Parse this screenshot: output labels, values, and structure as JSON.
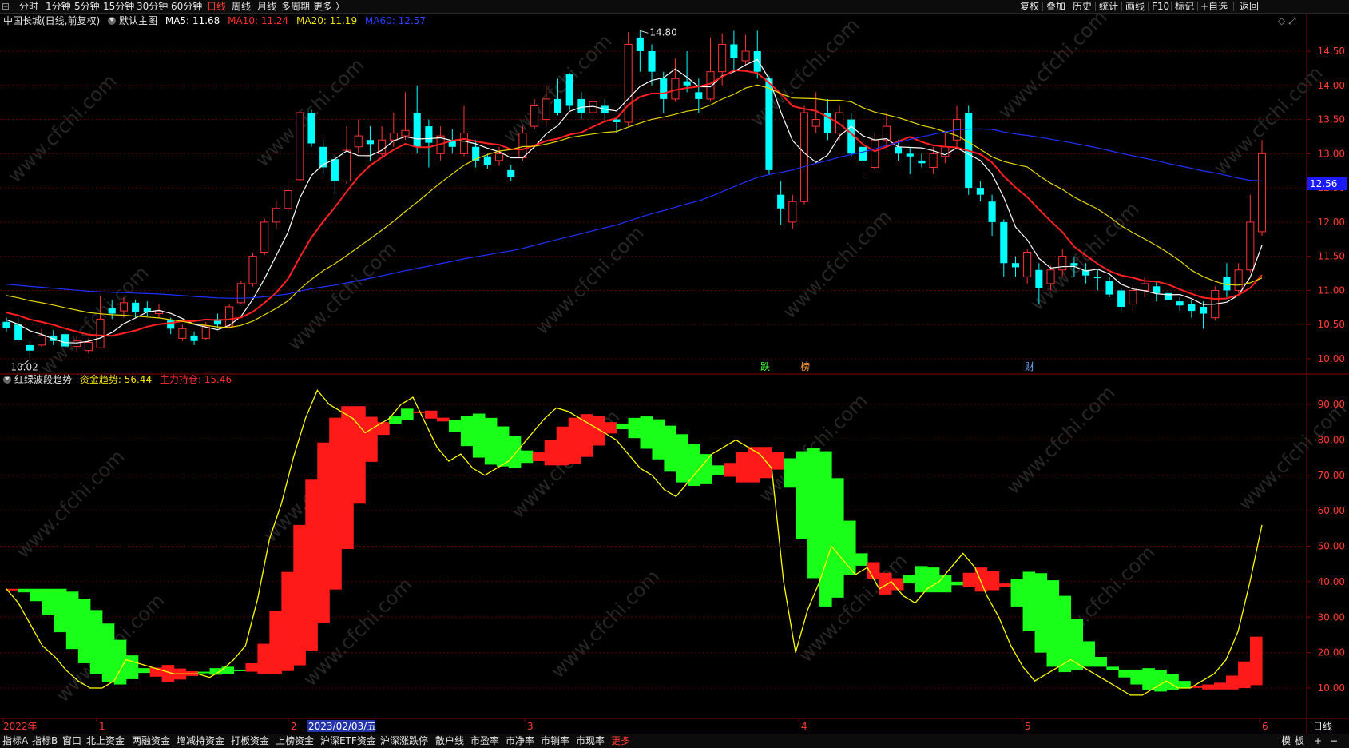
{
  "toolbar": {
    "periods": [
      "分时",
      "1分钟",
      "5分钟",
      "15分钟",
      "30分钟",
      "60分钟",
      "日线",
      "周线",
      "月线",
      "多周期",
      "更多 〉"
    ],
    "active_period": "日线",
    "right_items": [
      "复权",
      "叠加",
      "历史",
      "统计",
      "画线",
      "F10",
      "标记",
      "+自选",
      "返回"
    ]
  },
  "main_panel": {
    "stock_title": "中国长城(日线,前复权)",
    "main_chart_label": "默认主图",
    "ma": [
      {
        "label": "MA5:",
        "value": "11.68",
        "color": "#ffffff"
      },
      {
        "label": "MA10:",
        "value": "11.24",
        "color": "#ff2d2d"
      },
      {
        "label": "MA20:",
        "value": "11.19",
        "color": "#f0e000"
      },
      {
        "label": "MA60:",
        "value": "12.57",
        "color": "#2b3cff"
      }
    ],
    "y_ticks": [
      "14.50",
      "14.00",
      "13.50",
      "13.00",
      "12.50",
      "12.00",
      "11.50",
      "11.00",
      "10.50",
      "10.00"
    ],
    "high_label": "14.80",
    "low_label": "10.02",
    "price_tag": "12.56",
    "markers": [
      {
        "text": "跌",
        "color": "#3cff3c"
      },
      {
        "text": "榜",
        "color": "#ff9a3c"
      },
      {
        "text": "财",
        "color": "#6aa0ff"
      }
    ]
  },
  "sub_panel": {
    "indicator_name": "红绿波段趋势",
    "fund_trend": {
      "label": "资金趋势:",
      "value": "56.44",
      "color": "#f0e000"
    },
    "main_holding": {
      "label": "主力持仓:",
      "value": "15.46",
      "color": "#ff2d2d"
    },
    "y_ticks": [
      "90.00",
      "80.00",
      "70.00",
      "60.00",
      "50.00",
      "40.00",
      "30.00",
      "20.00",
      "10.00"
    ]
  },
  "x_axis": {
    "labels": [
      "2022年",
      "1",
      "2",
      "2023/02/03/五",
      "3",
      "4",
      "5",
      "6"
    ],
    "period_label": "日线"
  },
  "bottom_tabs": [
    "指标A",
    "指标B",
    "窗口",
    "北上资金",
    "两融资金",
    "增减持资金",
    "打板资金",
    "上榜资金",
    "沪深ETF资金",
    "沪深涨跌停",
    "散户线",
    "市盈率",
    "市净率",
    "市销率",
    "市现率",
    "更多"
  ],
  "bottom_right": [
    "模",
    "板",
    "+",
    "−"
  ],
  "watermark": "www.cfchi.com",
  "chart_data": {
    "type": "candlestick",
    "candles": [
      {
        "o": 10.54,
        "c": 10.45,
        "h": 10.6,
        "l": 10.4
      },
      {
        "o": 10.5,
        "c": 10.28,
        "h": 10.6,
        "l": 10.25
      },
      {
        "o": 10.2,
        "c": 10.12,
        "h": 10.28,
        "l": 10.02
      },
      {
        "o": 10.2,
        "c": 10.34,
        "h": 10.44,
        "l": 10.18
      },
      {
        "o": 10.34,
        "c": 10.26,
        "h": 10.42,
        "l": 10.2
      },
      {
        "o": 10.36,
        "c": 10.18,
        "h": 10.4,
        "l": 10.12
      },
      {
        "o": 10.18,
        "c": 10.26,
        "h": 10.34,
        "l": 10.1
      },
      {
        "o": 10.12,
        "c": 10.24,
        "h": 10.3,
        "l": 10.08
      },
      {
        "o": 10.16,
        "c": 10.58,
        "h": 10.92,
        "l": 10.15
      },
      {
        "o": 10.74,
        "c": 10.66,
        "h": 10.86,
        "l": 10.58
      },
      {
        "o": 10.7,
        "c": 10.82,
        "h": 10.9,
        "l": 10.6
      },
      {
        "o": 10.82,
        "c": 10.68,
        "h": 10.86,
        "l": 10.6
      },
      {
        "o": 10.74,
        "c": 10.68,
        "h": 10.84,
        "l": 10.62
      },
      {
        "o": 10.66,
        "c": 10.7,
        "h": 10.8,
        "l": 10.6
      },
      {
        "o": 10.56,
        "c": 10.44,
        "h": 10.6,
        "l": 10.36
      },
      {
        "o": 10.3,
        "c": 10.44,
        "h": 10.5,
        "l": 10.26
      },
      {
        "o": 10.34,
        "c": 10.26,
        "h": 10.4,
        "l": 10.2
      },
      {
        "o": 10.3,
        "c": 10.48,
        "h": 10.54,
        "l": 10.28
      },
      {
        "o": 10.58,
        "c": 10.5,
        "h": 10.66,
        "l": 10.44
      },
      {
        "o": 10.48,
        "c": 10.76,
        "h": 10.8,
        "l": 10.44
      },
      {
        "o": 10.82,
        "c": 11.1,
        "h": 11.14,
        "l": 10.8
      },
      {
        "o": 11.1,
        "c": 11.5,
        "h": 11.55,
        "l": 11.06
      },
      {
        "o": 11.56,
        "c": 12.0,
        "h": 12.05,
        "l": 11.52
      },
      {
        "o": 12.0,
        "c": 12.2,
        "h": 12.3,
        "l": 11.9
      },
      {
        "o": 12.2,
        "c": 12.46,
        "h": 12.6,
        "l": 12.1
      },
      {
        "o": 12.62,
        "c": 13.6,
        "h": 13.62,
        "l": 12.6
      },
      {
        "o": 13.6,
        "c": 13.15,
        "h": 13.64,
        "l": 13.1
      },
      {
        "o": 13.1,
        "c": 12.8,
        "h": 13.2,
        "l": 12.7
      },
      {
        "o": 12.92,
        "c": 12.6,
        "h": 13.0,
        "l": 12.4
      },
      {
        "o": 12.6,
        "c": 13.05,
        "h": 13.4,
        "l": 12.56
      },
      {
        "o": 13.1,
        "c": 13.26,
        "h": 13.5,
        "l": 13.0
      },
      {
        "o": 13.2,
        "c": 13.14,
        "h": 13.4,
        "l": 12.9
      },
      {
        "o": 13.0,
        "c": 13.2,
        "h": 13.4,
        "l": 12.96
      },
      {
        "o": 13.2,
        "c": 13.3,
        "h": 13.6,
        "l": 13.1
      },
      {
        "o": 13.26,
        "c": 13.34,
        "h": 13.9,
        "l": 13.2
      },
      {
        "o": 13.6,
        "c": 13.1,
        "h": 14.0,
        "l": 13.0
      },
      {
        "o": 13.4,
        "c": 13.16,
        "h": 13.5,
        "l": 12.8
      },
      {
        "o": 13.0,
        "c": 13.26,
        "h": 13.4,
        "l": 12.9
      },
      {
        "o": 13.2,
        "c": 13.1,
        "h": 13.36,
        "l": 13.0
      },
      {
        "o": 13.0,
        "c": 13.3,
        "h": 13.7,
        "l": 12.96
      },
      {
        "o": 13.1,
        "c": 12.9,
        "h": 13.2,
        "l": 12.8
      },
      {
        "o": 12.96,
        "c": 12.84,
        "h": 13.0,
        "l": 12.78
      },
      {
        "o": 12.9,
        "c": 13.0,
        "h": 13.1,
        "l": 12.82
      },
      {
        "o": 12.76,
        "c": 12.66,
        "h": 12.84,
        "l": 12.6
      },
      {
        "o": 12.94,
        "c": 13.3,
        "h": 13.4,
        "l": 12.9
      },
      {
        "o": 13.4,
        "c": 13.7,
        "h": 13.8,
        "l": 13.36
      },
      {
        "o": 13.5,
        "c": 13.8,
        "h": 14.0,
        "l": 13.4
      },
      {
        "o": 13.8,
        "c": 13.6,
        "h": 14.1,
        "l": 13.56
      },
      {
        "o": 14.16,
        "c": 13.7,
        "h": 14.18,
        "l": 13.64
      },
      {
        "o": 13.8,
        "c": 13.6,
        "h": 13.9,
        "l": 13.5
      },
      {
        "o": 13.6,
        "c": 13.76,
        "h": 13.84,
        "l": 13.5
      },
      {
        "o": 13.7,
        "c": 13.6,
        "h": 13.8,
        "l": 13.46
      },
      {
        "o": 13.5,
        "c": 13.46,
        "h": 13.54,
        "l": 13.3
      },
      {
        "o": 13.46,
        "c": 14.6,
        "h": 14.78,
        "l": 13.4
      },
      {
        "o": 14.7,
        "c": 14.5,
        "h": 14.8,
        "l": 14.2
      },
      {
        "o": 14.5,
        "c": 14.2,
        "h": 14.6,
        "l": 14.0
      },
      {
        "o": 14.1,
        "c": 13.8,
        "h": 14.2,
        "l": 13.6
      },
      {
        "o": 13.8,
        "c": 14.1,
        "h": 14.4,
        "l": 13.76
      },
      {
        "o": 14.06,
        "c": 14.0,
        "h": 14.5,
        "l": 13.9
      },
      {
        "o": 13.9,
        "c": 13.8,
        "h": 14.1,
        "l": 13.6
      },
      {
        "o": 13.8,
        "c": 14.2,
        "h": 14.7,
        "l": 13.76
      },
      {
        "o": 14.2,
        "c": 14.6,
        "h": 14.76,
        "l": 14.0
      },
      {
        "o": 14.6,
        "c": 14.4,
        "h": 14.8,
        "l": 14.2
      },
      {
        "o": 14.36,
        "c": 14.5,
        "h": 14.74,
        "l": 14.3
      },
      {
        "o": 14.5,
        "c": 14.2,
        "h": 14.8,
        "l": 14.1
      },
      {
        "o": 14.1,
        "c": 12.76,
        "h": 14.14,
        "l": 12.7
      },
      {
        "o": 12.4,
        "c": 12.2,
        "h": 12.6,
        "l": 11.96
      },
      {
        "o": 12.0,
        "c": 12.3,
        "h": 12.4,
        "l": 11.9
      },
      {
        "o": 12.3,
        "c": 13.6,
        "h": 13.7,
        "l": 12.26
      },
      {
        "o": 13.4,
        "c": 13.5,
        "h": 13.9,
        "l": 13.3
      },
      {
        "o": 13.6,
        "c": 13.3,
        "h": 13.8,
        "l": 13.2
      },
      {
        "o": 13.3,
        "c": 13.6,
        "h": 13.7,
        "l": 13.2
      },
      {
        "o": 13.5,
        "c": 13.0,
        "h": 13.6,
        "l": 12.96
      },
      {
        "o": 13.1,
        "c": 12.9,
        "h": 13.2,
        "l": 12.7
      },
      {
        "o": 12.8,
        "c": 13.2,
        "h": 13.3,
        "l": 12.76
      },
      {
        "o": 13.2,
        "c": 13.4,
        "h": 13.6,
        "l": 13.1
      },
      {
        "o": 13.1,
        "c": 13.0,
        "h": 13.2,
        "l": 12.9
      },
      {
        "o": 13.0,
        "c": 12.96,
        "h": 13.1,
        "l": 12.7
      },
      {
        "o": 12.9,
        "c": 12.86,
        "h": 13.0,
        "l": 12.8
      },
      {
        "o": 12.8,
        "c": 13.0,
        "h": 13.1,
        "l": 12.7
      },
      {
        "o": 12.96,
        "c": 13.1,
        "h": 13.3,
        "l": 12.86
      },
      {
        "o": 13.2,
        "c": 13.5,
        "h": 13.7,
        "l": 13.1
      },
      {
        "o": 13.6,
        "c": 12.5,
        "h": 13.7,
        "l": 12.4
      },
      {
        "o": 12.5,
        "c": 12.4,
        "h": 12.6,
        "l": 12.3
      },
      {
        "o": 12.3,
        "c": 12.0,
        "h": 12.4,
        "l": 11.8
      },
      {
        "o": 12.0,
        "c": 11.4,
        "h": 12.04,
        "l": 11.2
      },
      {
        "o": 11.4,
        "c": 11.34,
        "h": 11.5,
        "l": 11.2
      },
      {
        "o": 11.2,
        "c": 11.56,
        "h": 11.6,
        "l": 11.1
      },
      {
        "o": 11.3,
        "c": 11.04,
        "h": 11.4,
        "l": 10.8
      },
      {
        "o": 11.1,
        "c": 11.3,
        "h": 11.36,
        "l": 11.0
      },
      {
        "o": 11.3,
        "c": 11.5,
        "h": 11.6,
        "l": 11.2
      },
      {
        "o": 11.4,
        "c": 11.36,
        "h": 11.5,
        "l": 11.2
      },
      {
        "o": 11.3,
        "c": 11.22,
        "h": 11.4,
        "l": 11.1
      },
      {
        "o": 11.2,
        "c": 11.18,
        "h": 11.3,
        "l": 11.0
      },
      {
        "o": 11.14,
        "c": 10.94,
        "h": 11.2,
        "l": 10.9
      },
      {
        "o": 11.0,
        "c": 10.76,
        "h": 11.04,
        "l": 10.7
      },
      {
        "o": 10.8,
        "c": 11.0,
        "h": 11.1,
        "l": 10.7
      },
      {
        "o": 11.0,
        "c": 11.1,
        "h": 11.2,
        "l": 10.9
      },
      {
        "o": 11.06,
        "c": 10.96,
        "h": 11.14,
        "l": 10.84
      },
      {
        "o": 10.96,
        "c": 10.86,
        "h": 11.0,
        "l": 10.8
      },
      {
        "o": 10.84,
        "c": 10.78,
        "h": 10.9,
        "l": 10.7
      },
      {
        "o": 10.8,
        "c": 10.7,
        "h": 10.86,
        "l": 10.6
      },
      {
        "o": 10.76,
        "c": 10.66,
        "h": 10.84,
        "l": 10.44
      },
      {
        "o": 10.6,
        "c": 11.0,
        "h": 11.06,
        "l": 10.56
      },
      {
        "o": 11.2,
        "c": 11.0,
        "h": 11.4,
        "l": 10.9
      },
      {
        "o": 11.0,
        "c": 11.3,
        "h": 11.4,
        "l": 10.96
      },
      {
        "o": 11.3,
        "c": 12.0,
        "h": 12.4,
        "l": 11.26
      },
      {
        "o": 11.86,
        "c": 13.0,
        "h": 13.2,
        "l": 11.8
      }
    ]
  }
}
